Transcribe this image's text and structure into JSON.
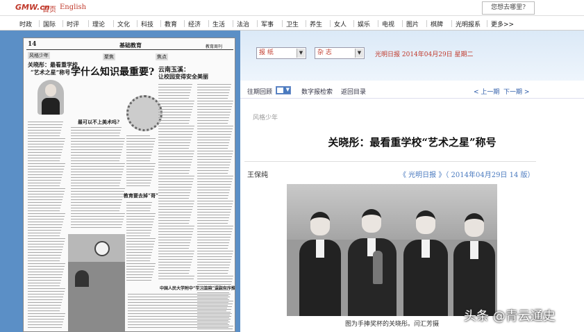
{
  "topbar": {
    "logo": "GMW.cn",
    "home": "首页",
    "english": "English",
    "search_placeholder": "您想去哪里?"
  },
  "nav": [
    "时政",
    "国际",
    "时评",
    "理论",
    "文化",
    "科技",
    "教育",
    "经济",
    "生活",
    "法治",
    "军事",
    "卫生",
    "养生",
    "女人",
    "娱乐",
    "电视",
    "图片",
    "棋牌",
    "光明报系",
    "更多>>"
  ],
  "paper": {
    "page_num": "14",
    "section": "基础教育",
    "edition_tag": "教育周刊",
    "col1_tag": "风格少年",
    "col1_title_line1": "关晓彤：最看重学校",
    "col1_title_line2": "“艺术之星”称号",
    "headline": "学什么知识最重要?",
    "col2_tag": "聚焦",
    "col3_tag": "焦点",
    "col3_title_line1": "云南玉溪：",
    "col3_title_line2": "让校园变得安全美丽",
    "sub1": "最可以不上美术吗?",
    "sub2": "教育要去掉“哥”",
    "sub3": "中国人民大学附中“学习策略”课题有序推进"
  },
  "controls": {
    "select1": "报 纸",
    "select2": "杂 志",
    "date_line": "光明日报 2014年04月29日 星期二",
    "history": "往期回顾",
    "digital_search": "数字报检索",
    "back_to_index": "返回目录",
    "prev": "< 上一期",
    "next": "下一期 >"
  },
  "article": {
    "section": "风格少年",
    "title": "关晓彤：最看重学校“艺术之星”称号",
    "author": "王保纯",
    "source": "《 光明日报 》（ 2014年04月29日   14 版）",
    "caption": "图为手捧奖杯的关晓彤。闫汇芳摄"
  },
  "watermark": "头条 @青云通史",
  "colors": {
    "accent_red": "#c0392b",
    "panel_blue": "#5b8fc6",
    "link_blue": "#4a7abf"
  }
}
